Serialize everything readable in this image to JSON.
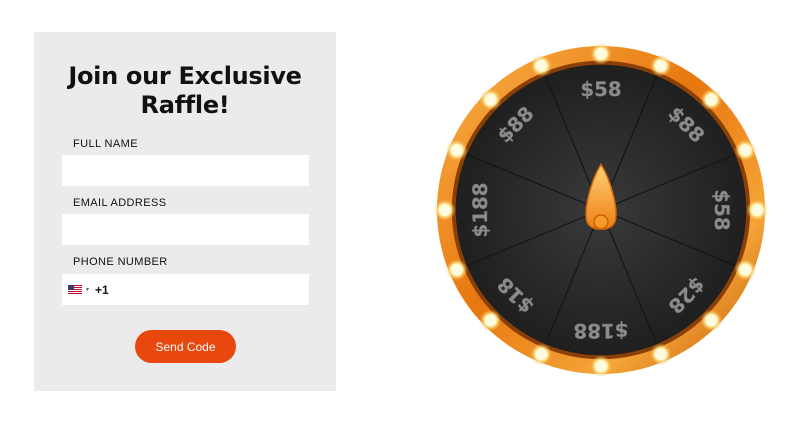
{
  "form": {
    "title_line1": "Join our Exclusive",
    "title_line2": "Raffle!",
    "full_name_label": "FULL NAME",
    "full_name_value": "",
    "email_label": "EMAIL ADDRESS",
    "email_value": "",
    "phone_label": "PHONE NUMBER",
    "phone_country_icon": "us-flag-icon",
    "phone_dial_code": "+1",
    "phone_value": "",
    "send_button_label": "Send Code",
    "accent_color": "#e8470e"
  },
  "wheel": {
    "prizes": [
      "$58",
      "$88",
      "$58",
      "$28",
      "$188",
      "$18",
      "$188",
      "$88"
    ],
    "pointer_icon": "pointer-icon",
    "rim_color": "#f08a1c",
    "face_color": "#262626",
    "text_color": "#8c8c8c"
  }
}
